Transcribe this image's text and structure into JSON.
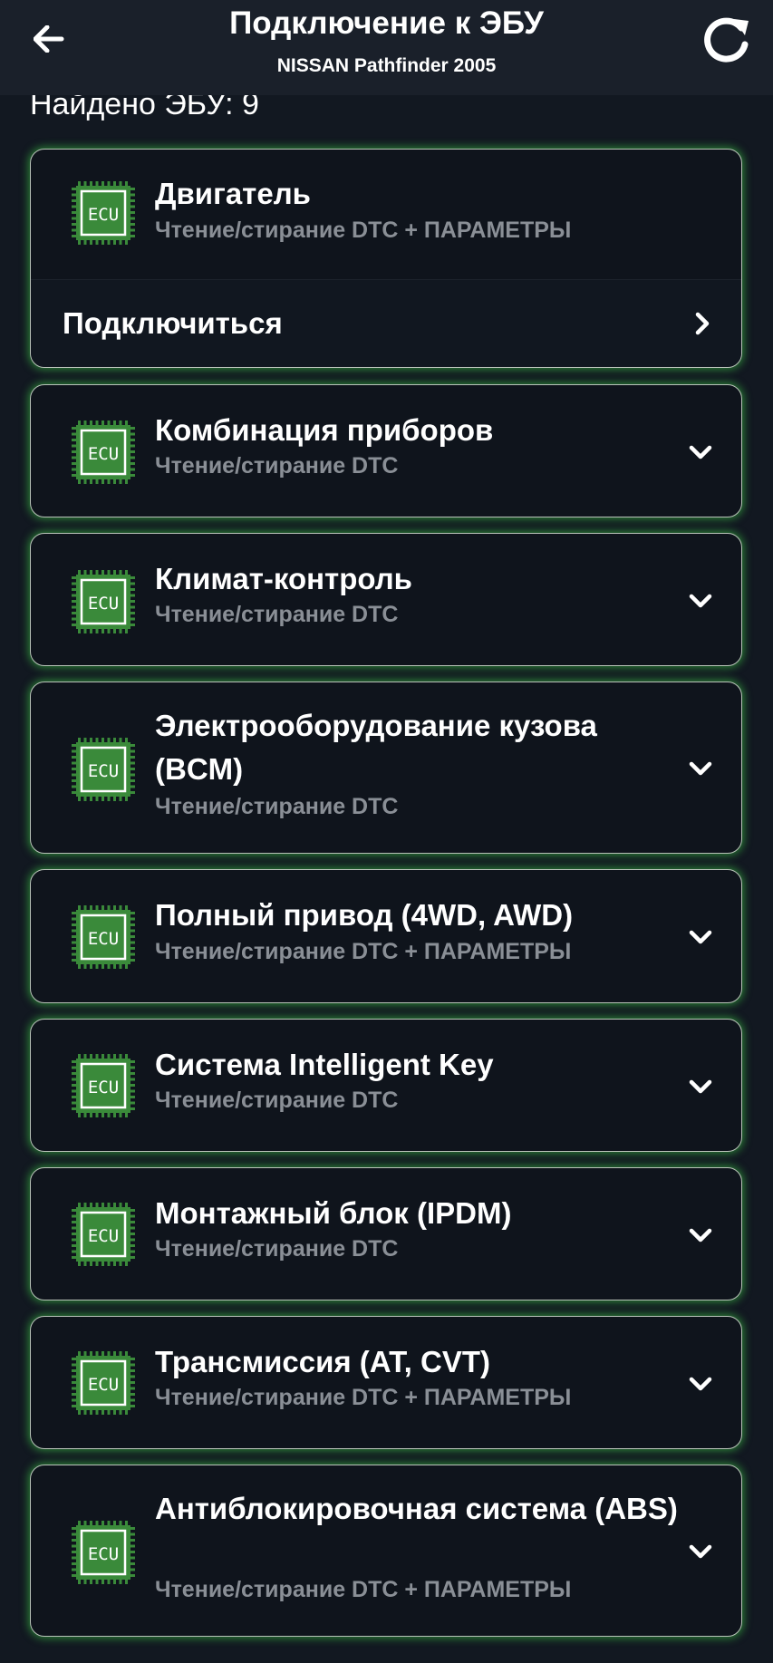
{
  "header": {
    "title": "Подключение к ЭБУ",
    "subtitle": "NISSAN Pathfinder 2005",
    "back_icon": "arrow-left-icon",
    "refresh_icon": "refresh-icon"
  },
  "found_label": "Найдено ЭБУ: 9",
  "ecu_chip_text": "ECU",
  "connect_label": "Подключиться",
  "colors": {
    "background": "#121821",
    "header": "#1a202a",
    "card": "#0f141c",
    "accent_glow": "#3ccd46",
    "chip_green": "#3a8a3a",
    "subtext": "#8a8f96"
  },
  "ecus": [
    {
      "title": "Двигатель",
      "subtitle": "Чтение/стирание DTC + ПАРАМЕТРЫ",
      "expanded": true
    },
    {
      "title": "Комбинация приборов",
      "subtitle": "Чтение/стирание DTC",
      "expanded": false
    },
    {
      "title": "Климат-контроль",
      "subtitle": "Чтение/стирание DTC",
      "expanded": false
    },
    {
      "title": "Электрооборудование кузова (BCM)",
      "subtitle": "Чтение/стирание DTC",
      "expanded": false
    },
    {
      "title": "Полный привод (4WD, AWD)",
      "subtitle": "Чтение/стирание DTC + ПАРАМЕТРЫ",
      "expanded": false
    },
    {
      "title": "Система Intelligent Key",
      "subtitle": "Чтение/стирание DTC",
      "expanded": false
    },
    {
      "title": "Монтажный блок (IPDM)",
      "subtitle": "Чтение/стирание DTC",
      "expanded": false
    },
    {
      "title": "Трансмиссия (AT, CVT)",
      "subtitle": "Чтение/стирание DTC + ПАРАМЕТРЫ",
      "expanded": false
    },
    {
      "title": "Антиблокировочная система (ABS)",
      "subtitle": "Чтение/стирание DTC + ПАРАМЕТРЫ",
      "expanded": false
    }
  ]
}
